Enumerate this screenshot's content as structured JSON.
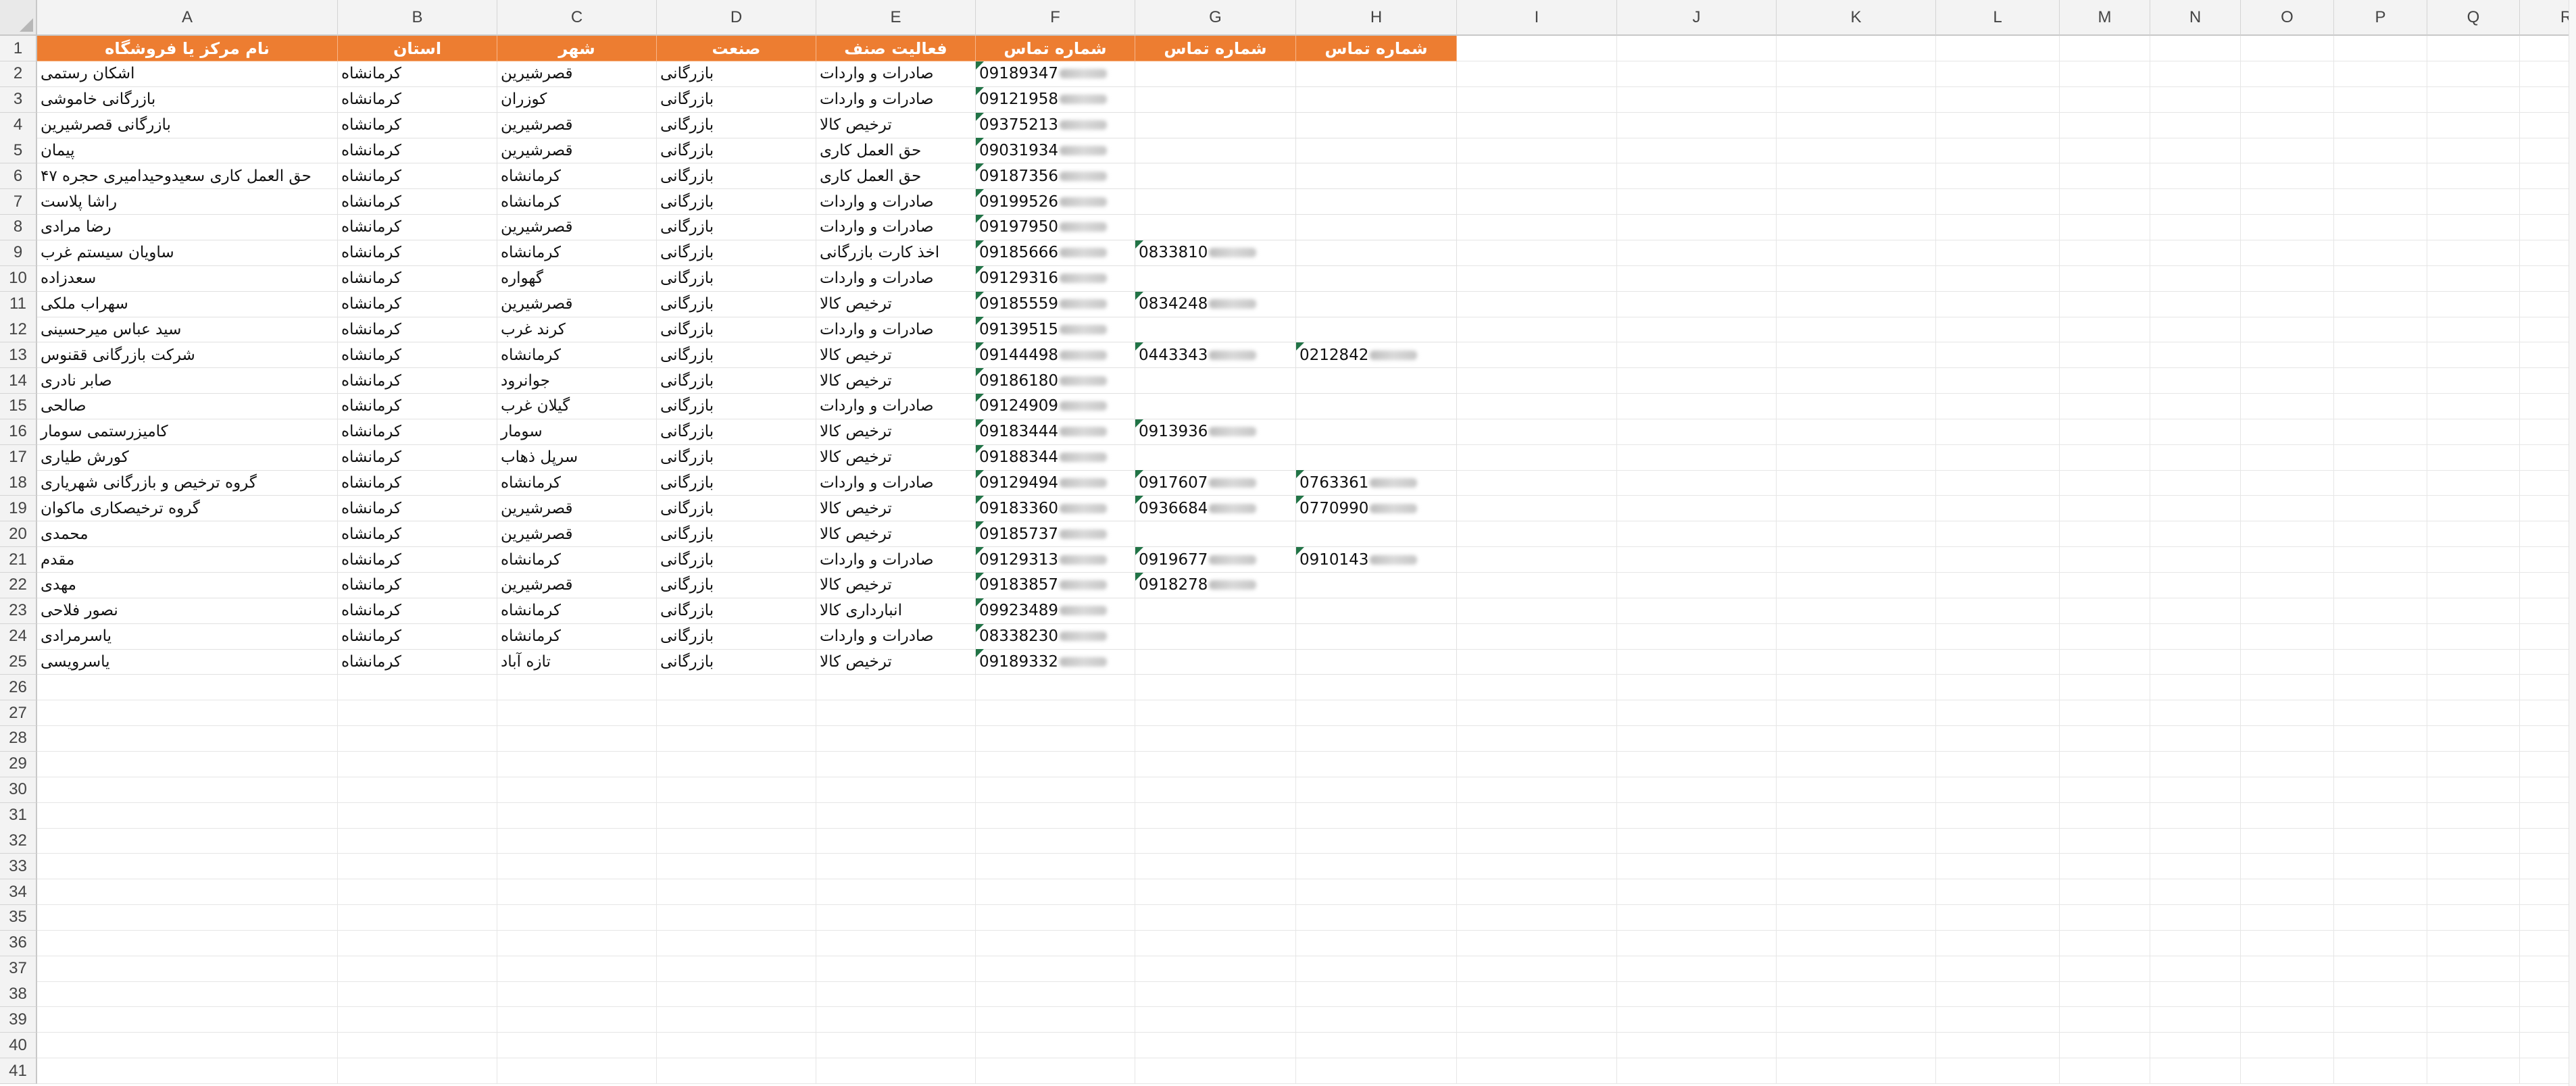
{
  "columns": [
    "A",
    "B",
    "C",
    "D",
    "E",
    "F",
    "G",
    "H",
    "I",
    "J",
    "K",
    "L",
    "M",
    "N",
    "O",
    "P",
    "Q",
    "R"
  ],
  "rows": [
    1,
    2,
    3,
    4,
    5,
    6,
    7,
    8,
    9,
    10,
    11,
    12,
    13,
    14,
    15,
    16,
    17,
    18,
    19,
    20,
    21,
    22,
    23,
    24,
    25,
    26,
    27,
    28,
    29,
    30,
    31,
    32,
    33,
    34,
    35,
    36,
    37,
    38,
    39,
    40,
    41
  ],
  "headers": {
    "A": "نام مرکز یا فروشگاه",
    "B": "استان",
    "C": "شهر",
    "D": "صنعت",
    "E": "فعالیت صنف",
    "F": "شماره تماس",
    "G": "شماره تماس",
    "H": "شماره تماس"
  },
  "records": [
    {
      "A": "اشکان رستمی",
      "B": "کرمانشاه",
      "C": "قصرشیرین",
      "D": "بازرگانی",
      "E": "صادرات و واردات",
      "F": "09189347",
      "G": "",
      "H": ""
    },
    {
      "A": "بازرگانی خاموشی",
      "B": "کرمانشاه",
      "C": "کوزران",
      "D": "بازرگانی",
      "E": "صادرات و واردات",
      "F": "09121958",
      "G": "",
      "H": ""
    },
    {
      "A": "بازرگانی قصرشیرین",
      "B": "کرمانشاه",
      "C": "قصرشیرین",
      "D": "بازرگانی",
      "E": "ترخیص کالا",
      "F": "09375213",
      "G": "",
      "H": ""
    },
    {
      "A": "پیمان",
      "B": "کرمانشاه",
      "C": "قصرشیرین",
      "D": "بازرگانی",
      "E": "حق العمل کاری",
      "F": "09031934",
      "G": "",
      "H": ""
    },
    {
      "A": "حق العمل کاری سعیدوحیدامیری حجره ۴۷",
      "B": "کرمانشاه",
      "C": "کرمانشاه",
      "D": "بازرگانی",
      "E": "حق العمل کاری",
      "F": "09187356",
      "G": "",
      "H": ""
    },
    {
      "A": "راشا پلاست",
      "B": "کرمانشاه",
      "C": "کرمانشاه",
      "D": "بازرگانی",
      "E": "صادرات و واردات",
      "F": "09199526",
      "G": "",
      "H": ""
    },
    {
      "A": "رضا مرادی",
      "B": "کرمانشاه",
      "C": "قصرشیرین",
      "D": "بازرگانی",
      "E": "صادرات و واردات",
      "F": "09197950",
      "G": "",
      "H": ""
    },
    {
      "A": "ساویان سیستم غرب",
      "B": "کرمانشاه",
      "C": "کرمانشاه",
      "D": "بازرگانی",
      "E": "اخذ کارت بازرگانی",
      "F": "09185666",
      "G": "0833810",
      "H": ""
    },
    {
      "A": "سعدزاده",
      "B": "کرمانشاه",
      "C": "گهواره",
      "D": "بازرگانی",
      "E": "صادرات و واردات",
      "F": "09129316",
      "G": "",
      "H": ""
    },
    {
      "A": "سهراب ملکی",
      "B": "کرمانشاه",
      "C": "قصرشیرین",
      "D": "بازرگانی",
      "E": "ترخیص کالا",
      "F": "09185559",
      "G": "0834248",
      "H": ""
    },
    {
      "A": "سید عباس میرحسینی",
      "B": "کرمانشاه",
      "C": "کرند غرب",
      "D": "بازرگانی",
      "E": "صادرات و واردات",
      "F": "09139515",
      "G": "",
      "H": ""
    },
    {
      "A": "شرکت بازرگانی ققنوس",
      "B": "کرمانشاه",
      "C": "کرمانشاه",
      "D": "بازرگانی",
      "E": "ترخیص کالا",
      "F": "09144498",
      "G": "0443343",
      "H": "0212842"
    },
    {
      "A": "صابر نادری",
      "B": "کرمانشاه",
      "C": "جوانرود",
      "D": "بازرگانی",
      "E": "ترخیص کالا",
      "F": "09186180",
      "G": "",
      "H": ""
    },
    {
      "A": "صالحی",
      "B": "کرمانشاه",
      "C": "گیلان غرب",
      "D": "بازرگانی",
      "E": "صادرات و واردات",
      "F": "09124909",
      "G": "",
      "H": ""
    },
    {
      "A": "کامیزرستمی سومار",
      "B": "کرمانشاه",
      "C": "سومار",
      "D": "بازرگانی",
      "E": "ترخیص کالا",
      "F": "09183444",
      "G": "0913936",
      "H": ""
    },
    {
      "A": "کورش طیاری",
      "B": "کرمانشاه",
      "C": "سرپل ذهاب",
      "D": "بازرگانی",
      "E": "ترخیص کالا",
      "F": "09188344",
      "G": "",
      "H": ""
    },
    {
      "A": "گروه ترخیص و بازرگانی شهریاری",
      "B": "کرمانشاه",
      "C": "کرمانشاه",
      "D": "بازرگانی",
      "E": "صادرات و واردات",
      "F": "09129494",
      "G": "0917607",
      "H": "0763361"
    },
    {
      "A": "گروه ترخیصکاری ماکوان",
      "B": "کرمانشاه",
      "C": "قصرشیرین",
      "D": "بازرگانی",
      "E": "ترخیص کالا",
      "F": "09183360",
      "G": "0936684",
      "H": "0770990"
    },
    {
      "A": "محمدی",
      "B": "کرمانشاه",
      "C": "قصرشیرین",
      "D": "بازرگانی",
      "E": "ترخیص کالا",
      "F": "09185737",
      "G": "",
      "H": ""
    },
    {
      "A": "مقدم",
      "B": "کرمانشاه",
      "C": "کرمانشاه",
      "D": "بازرگانی",
      "E": "صادرات و واردات",
      "F": "09129313",
      "G": "0919677",
      "H": "0910143"
    },
    {
      "A": "مهدی",
      "B": "کرمانشاه",
      "C": "قصرشیرین",
      "D": "بازرگانی",
      "E": "ترخیص کالا",
      "F": "09183857",
      "G": "0918278",
      "H": ""
    },
    {
      "A": "نصور فلاحی",
      "B": "کرمانشاه",
      "C": "کرمانشاه",
      "D": "بازرگانی",
      "E": "انبارداری کالا",
      "F": "09923489",
      "G": "",
      "H": ""
    },
    {
      "A": "یاسرمرادی",
      "B": "کرمانشاه",
      "C": "کرمانشاه",
      "D": "بازرگانی",
      "E": "صادرات و واردات",
      "F": "08338230",
      "G": "",
      "H": ""
    },
    {
      "A": "یاسرویسی",
      "B": "کرمانشاه",
      "C": "تازه آباد",
      "D": "بازرگانی",
      "E": "ترخیص کالا",
      "F": "09189332",
      "G": "",
      "H": ""
    }
  ],
  "colors": {
    "header_fill": "#ed7d31",
    "header_text": "#ffffff",
    "number_as_text_marker": "#217346"
  }
}
